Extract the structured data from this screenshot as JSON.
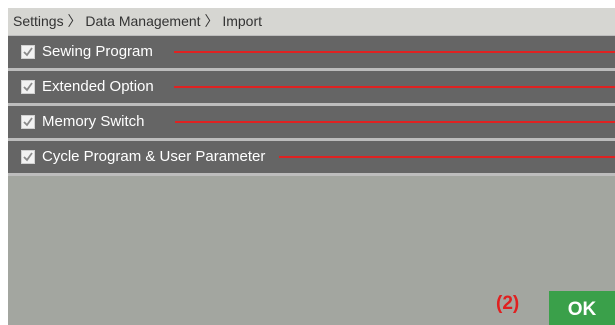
{
  "breadcrumb": {
    "items": [
      "Settings",
      "Data Management",
      "Import"
    ],
    "separator": "〉"
  },
  "import_items": [
    {
      "label": "Sewing Program",
      "checked": true
    },
    {
      "label": "Extended Option",
      "checked": true
    },
    {
      "label": "Memory Switch",
      "checked": true
    },
    {
      "label": "Cycle Program & User Parameter",
      "checked": true
    }
  ],
  "annotation": {
    "marker": "(2)",
    "color": "#e02020"
  },
  "ok_button": {
    "label": "OK",
    "color": "#3aa04a"
  },
  "colors": {
    "background": "#a3a6a0",
    "breadcrumb_bar": "#d6d6d2",
    "item_row": "#656565",
    "callout_line": "#e02222"
  }
}
